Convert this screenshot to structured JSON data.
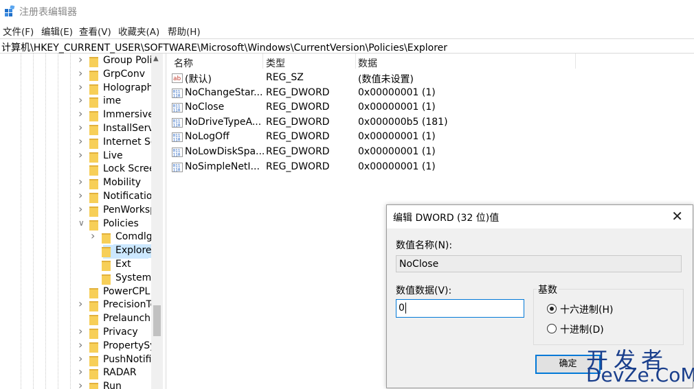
{
  "window": {
    "title": "注册表编辑器"
  },
  "menu": [
    "文件(F)",
    "编辑(E)",
    "查看(V)",
    "收藏夹(A)",
    "帮助(H)"
  ],
  "address": "计算机\\HKEY_CURRENT_USER\\SOFTWARE\\Microsoft\\Windows\\CurrentVersion\\Policies\\Explorer",
  "tree": [
    {
      "label": "Group Poli",
      "expand": "collapsed",
      "level": 1
    },
    {
      "label": "GrpConv",
      "expand": "collapsed",
      "level": 1
    },
    {
      "label": "Holograph",
      "expand": "collapsed",
      "level": 1
    },
    {
      "label": "ime",
      "expand": "collapsed",
      "level": 1
    },
    {
      "label": "Immersive",
      "expand": "collapsed",
      "level": 1
    },
    {
      "label": "InstallServi",
      "expand": "collapsed",
      "level": 1
    },
    {
      "label": "Internet Se",
      "expand": "collapsed",
      "level": 1
    },
    {
      "label": "Live",
      "expand": "collapsed",
      "level": 1
    },
    {
      "label": "Lock Scree",
      "expand": "none",
      "level": 1
    },
    {
      "label": "Mobility",
      "expand": "collapsed",
      "level": 1
    },
    {
      "label": "Notificatio",
      "expand": "collapsed",
      "level": 1
    },
    {
      "label": "PenWorksp",
      "expand": "collapsed",
      "level": 1
    },
    {
      "label": "Policies",
      "expand": "expanded",
      "level": 1
    },
    {
      "label": "Comdlg",
      "expand": "collapsed",
      "level": 2
    },
    {
      "label": "Explorer",
      "expand": "none",
      "level": 2,
      "selected": true
    },
    {
      "label": "Ext",
      "expand": "none",
      "level": 2
    },
    {
      "label": "System",
      "expand": "none",
      "level": 2
    },
    {
      "label": "PowerCPL",
      "expand": "none",
      "level": 1
    },
    {
      "label": "PrecisionTo",
      "expand": "collapsed",
      "level": 1
    },
    {
      "label": "Prelaunch",
      "expand": "none",
      "level": 1
    },
    {
      "label": "Privacy",
      "expand": "collapsed",
      "level": 1
    },
    {
      "label": "PropertySy",
      "expand": "collapsed",
      "level": 1
    },
    {
      "label": "PushNotific",
      "expand": "collapsed",
      "level": 1
    },
    {
      "label": "RADAR",
      "expand": "collapsed",
      "level": 1
    },
    {
      "label": "Run",
      "expand": "collapsed",
      "level": 1
    }
  ],
  "columns": {
    "name": "名称",
    "type": "类型",
    "data": "数据"
  },
  "values": [
    {
      "name": "(默认)",
      "type": "REG_SZ",
      "data": "(数值未设置)",
      "icon": "string-value-icon"
    },
    {
      "name": "NoChangeStar...",
      "type": "REG_DWORD",
      "data": "0x00000001 (1)",
      "icon": "dword-value-icon"
    },
    {
      "name": "NoClose",
      "type": "REG_DWORD",
      "data": "0x00000001 (1)",
      "icon": "dword-value-icon"
    },
    {
      "name": "NoDriveTypeA...",
      "type": "REG_DWORD",
      "data": "0x000000b5 (181)",
      "icon": "dword-value-icon"
    },
    {
      "name": "NoLogOff",
      "type": "REG_DWORD",
      "data": "0x00000001 (1)",
      "icon": "dword-value-icon"
    },
    {
      "name": "NoLowDiskSpa...",
      "type": "REG_DWORD",
      "data": "0x00000001 (1)",
      "icon": "dword-value-icon"
    },
    {
      "name": "NoSimpleNetI...",
      "type": "REG_DWORD",
      "data": "0x00000001 (1)",
      "icon": "dword-value-icon"
    }
  ],
  "dialog": {
    "title": "编辑 DWORD (32 位)值",
    "name_label": "数值名称(N):",
    "name_value": "NoClose",
    "data_label": "数值数据(V):",
    "data_value": "0",
    "base_label": "基数",
    "hex_label": "十六进制(H)",
    "dec_label": "十进制(D)",
    "base_selected": "hex",
    "ok_label": "确定"
  },
  "watermark": {
    "line1": "开发者",
    "line2": "DevZe.CoM"
  },
  "colors": {
    "selection": "#cce8ff",
    "accent": "#0078d7",
    "folder": "#f7cf58",
    "watermark": "#1a3f8c"
  }
}
